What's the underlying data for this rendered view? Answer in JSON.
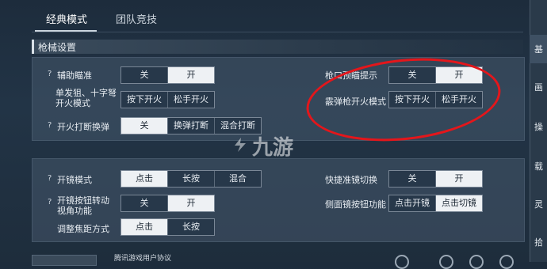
{
  "tabs": [
    {
      "label": "经典模式"
    },
    {
      "label": "团队竞技"
    }
  ],
  "section_title": "枪械设置",
  "help_mark": "?",
  "panel1": {
    "aim_assist": {
      "label": "辅助瞄准",
      "options": [
        "关",
        "开"
      ],
      "selected": 1
    },
    "single_shot": {
      "label": "单发狙、十字弩开火模式",
      "options": [
        "按下开火",
        "松手开火"
      ],
      "selected": null
    },
    "fire_break_switch": {
      "label": "开火打断换弹",
      "options": [
        "关",
        "换弹打断",
        "混合打断"
      ],
      "selected": 0
    },
    "muzzle_tip": {
      "label": "枪口预瞄提示",
      "options": [
        "关",
        "开"
      ],
      "selected": 1
    },
    "grenade_fire": {
      "label": "霰弹枪开火模式",
      "options": [
        "按下开火",
        "松手开火"
      ],
      "selected": null
    }
  },
  "panel2": {
    "scope_mode": {
      "label": "开镜模式",
      "options": [
        "点击",
        "长按",
        "混合"
      ],
      "selected": 0
    },
    "scope_button_turn": {
      "label": "开镜按钮转动视角功能",
      "options": [
        "关",
        "开"
      ],
      "selected": 1
    },
    "zoom_method": {
      "label": "调整焦距方式",
      "options": [
        "点击",
        "长按"
      ],
      "selected": 0
    },
    "quick_scope_switch": {
      "label": "快捷准镜切换",
      "options": [
        "关",
        "开"
      ],
      "selected": 1
    },
    "side_scope": {
      "label": "侧面镜按钮功能",
      "options": [
        "点击开镜",
        "点击切镜"
      ],
      "selected": 1
    }
  },
  "watermark": "九游",
  "sidebar": [
    "基",
    "画",
    "操",
    "载",
    "灵",
    "拾"
  ],
  "bottom": {
    "agreement": "腾讯游戏用户协议"
  },
  "colors": {
    "annotation": "#e4161b",
    "selected_bg": "#eef1f4"
  }
}
